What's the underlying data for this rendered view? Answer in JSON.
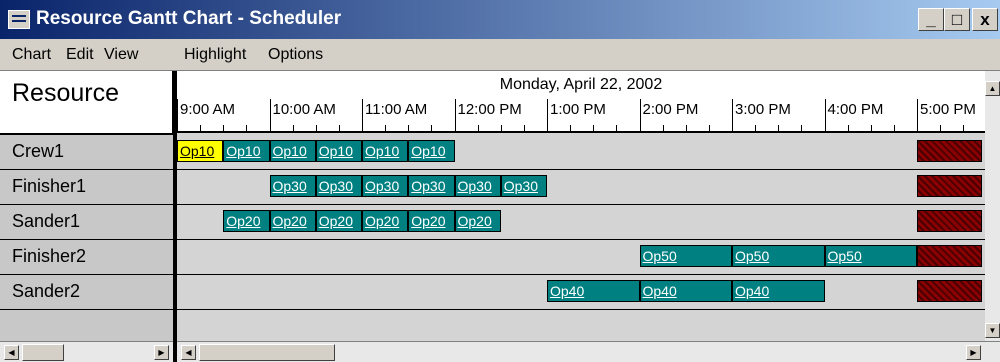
{
  "window": {
    "title": "Resource Gantt Chart - Scheduler",
    "minimize_label": "_",
    "maximize_label": "□",
    "close_label": "x"
  },
  "menu": [
    "Chart",
    "Edit",
    "View",
    "Highlight",
    "Options"
  ],
  "resource_header": "Resource",
  "resources": [
    "Crew1",
    "Finisher1",
    "Sander1",
    "Finisher2",
    "Sander2"
  ],
  "date_label": "Monday, April 22, 2002",
  "time_labels": [
    "9:00 AM",
    "10:00 AM",
    "11:00 AM",
    "12:00 PM",
    "1:00 PM",
    "2:00 PM",
    "3:00 PM",
    "4:00 PM",
    "5:00 PM"
  ],
  "operations": [
    {
      "resource": 0,
      "label": "Op10",
      "start": 9.0,
      "end": 9.5,
      "highlighted": true
    },
    {
      "resource": 0,
      "label": "Op10",
      "start": 9.5,
      "end": 10.0
    },
    {
      "resource": 0,
      "label": "Op10",
      "start": 10.0,
      "end": 10.5
    },
    {
      "resource": 0,
      "label": "Op10",
      "start": 10.5,
      "end": 11.0
    },
    {
      "resource": 0,
      "label": "Op10",
      "start": 11.0,
      "end": 11.5
    },
    {
      "resource": 0,
      "label": "Op10",
      "start": 11.5,
      "end": 12.0
    },
    {
      "resource": 1,
      "label": "Op30",
      "start": 10.0,
      "end": 10.5
    },
    {
      "resource": 1,
      "label": "Op30",
      "start": 10.5,
      "end": 11.0
    },
    {
      "resource": 1,
      "label": "Op30",
      "start": 11.0,
      "end": 11.5
    },
    {
      "resource": 1,
      "label": "Op30",
      "start": 11.5,
      "end": 12.0
    },
    {
      "resource": 1,
      "label": "Op30",
      "start": 12.0,
      "end": 12.5
    },
    {
      "resource": 1,
      "label": "Op30",
      "start": 12.5,
      "end": 13.0
    },
    {
      "resource": 2,
      "label": "Op20",
      "start": 9.5,
      "end": 10.0
    },
    {
      "resource": 2,
      "label": "Op20",
      "start": 10.0,
      "end": 10.5
    },
    {
      "resource": 2,
      "label": "Op20",
      "start": 10.5,
      "end": 11.0
    },
    {
      "resource": 2,
      "label": "Op20",
      "start": 11.0,
      "end": 11.5
    },
    {
      "resource": 2,
      "label": "Op20",
      "start": 11.5,
      "end": 12.0
    },
    {
      "resource": 2,
      "label": "Op20",
      "start": 12.0,
      "end": 12.5
    },
    {
      "resource": 3,
      "label": "Op50",
      "start": 14.0,
      "end": 15.0
    },
    {
      "resource": 3,
      "label": "Op50",
      "start": 15.0,
      "end": 16.0
    },
    {
      "resource": 3,
      "label": "Op50",
      "start": 16.0,
      "end": 17.0
    },
    {
      "resource": 4,
      "label": "Op40",
      "start": 13.0,
      "end": 14.0
    },
    {
      "resource": 4,
      "label": "Op40",
      "start": 14.0,
      "end": 15.0
    },
    {
      "resource": 4,
      "label": "Op40",
      "start": 15.0,
      "end": 16.0
    }
  ],
  "offshift_start_hour": 17.0,
  "colors": {
    "operation": "#008080",
    "highlight": "#ffff00",
    "offshift": "#8b0000",
    "titlebar_start": "#0a246a",
    "titlebar_end": "#a6caf0"
  }
}
